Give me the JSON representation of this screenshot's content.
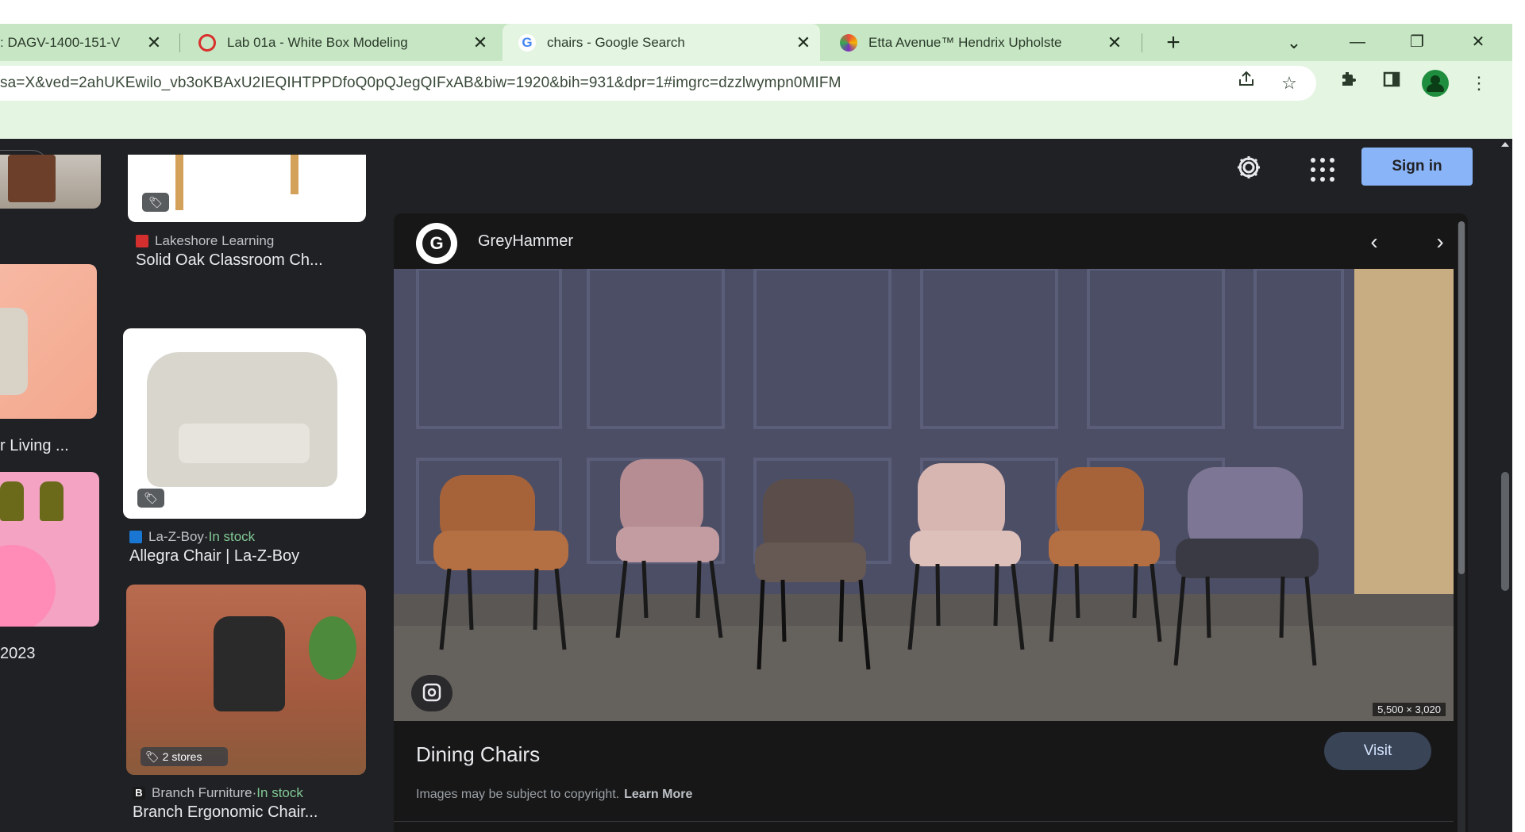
{
  "tabs": [
    {
      "title": ": DAGV-1400-151-V",
      "active": false
    },
    {
      "title": "Lab 01a - White Box Modeling",
      "active": false
    },
    {
      "title": "chairs - Google Search",
      "active": true
    },
    {
      "title": "Etta Avenue™ Hendrix Upholste",
      "active": false
    }
  ],
  "tab_close_glyph": "✕",
  "new_tab_glyph": "+",
  "window_controls": {
    "menu": "⌄",
    "minimize": "—",
    "restore": "❐",
    "close": "✕"
  },
  "address_bar": {
    "url": "sa=X&ved=2ahUKEwilo_vb3oKBAxU2IEQIHTPPDfoQ0pQJegQIFxAB&biw=1920&bih=931&dpr=1#imgrc=dzzlwympn0MIFM"
  },
  "toolbar_icons": [
    "share-icon",
    "bookmark-star-icon",
    "extensions-icon",
    "side-panel-icon",
    "profile-icon",
    "menu-icon"
  ],
  "header": {
    "signin_label": "Sign in"
  },
  "results": [
    {
      "source": "Lakeshore Learning",
      "in_stock": "",
      "caption": "Solid Oak Classroom Ch..."
    },
    {
      "source": "La-Z-Boy",
      "in_stock": "In stock",
      "caption": "Allegra Chair | La-Z-Boy"
    },
    {
      "source": "Branch Furniture",
      "in_stock": "In stock",
      "caption": "Branch Ergonomic Chair...",
      "badge": "2 stores"
    }
  ],
  "left_captions": {
    "living": "r Living ...",
    "year": "2023"
  },
  "stock_sep": " · ",
  "preview": {
    "publisher": "GreyHammer",
    "publisher_initial": "G",
    "title": "Dining Chairs",
    "visit_label": "Visit",
    "dimensions": "5,500 × 3,020",
    "copyright_text": "Images may be subject to copyright.",
    "learn_more": "Learn More"
  },
  "colors": {
    "tabstrip": "#c7e7c4",
    "toolbar": "#e4f5e2",
    "page_bg": "#202124",
    "accent_blue": "#8ab4f8",
    "in_stock_green": "#81c995"
  }
}
